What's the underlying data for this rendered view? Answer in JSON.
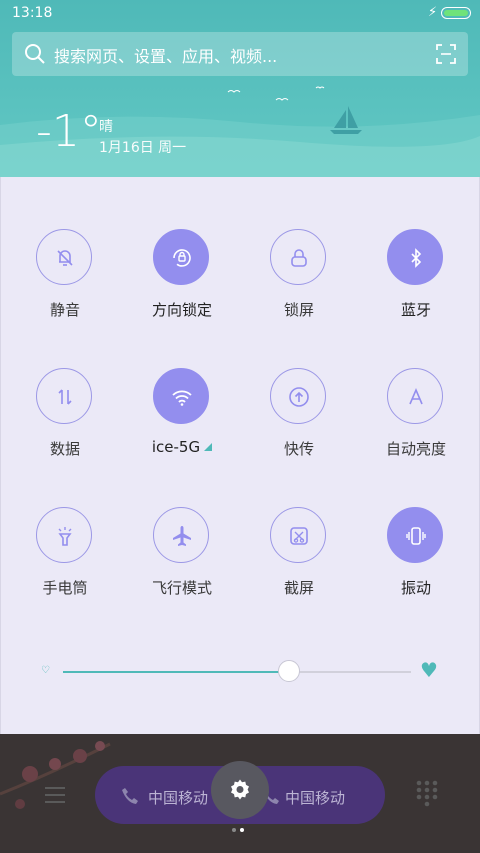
{
  "status_bar": {
    "time": "13:18"
  },
  "search": {
    "placeholder": "搜索网页、设置、应用、视频..."
  },
  "weather": {
    "temperature": "-1°",
    "condition": "晴",
    "date": "1月16日 周一"
  },
  "toggles": [
    {
      "label": "静音",
      "icon": "mute-bell-icon",
      "on": false
    },
    {
      "label": "方向锁定",
      "icon": "rotation-lock-icon",
      "on": true
    },
    {
      "label": "锁屏",
      "icon": "lock-icon",
      "on": false
    },
    {
      "label": "蓝牙",
      "icon": "bluetooth-icon",
      "on": true
    },
    {
      "label": "数据",
      "icon": "mobile-data-icon",
      "on": false
    },
    {
      "label": "ice-5G",
      "icon": "wifi-icon",
      "on": true
    },
    {
      "label": "快传",
      "icon": "quick-transfer-icon",
      "on": false
    },
    {
      "label": "自动亮度",
      "icon": "auto-brightness-icon",
      "on": false
    },
    {
      "label": "手电筒",
      "icon": "flashlight-icon",
      "on": false
    },
    {
      "label": "飞行模式",
      "icon": "airplane-icon",
      "on": false
    },
    {
      "label": "截屏",
      "icon": "screenshot-icon",
      "on": false
    },
    {
      "label": "振动",
      "icon": "vibrate-icon",
      "on": true
    }
  ],
  "brightness": {
    "level": 0.65
  },
  "dock": {
    "carrier_1": "中国移动",
    "carrier_2": "中国移动",
    "page_index": 1,
    "page_count": 2
  },
  "colors": {
    "accent": "#4fb9b8",
    "toggle_on": "#938eee",
    "toggle_outline": "#9c98e6",
    "panel_bg": "#ebe9f7"
  }
}
